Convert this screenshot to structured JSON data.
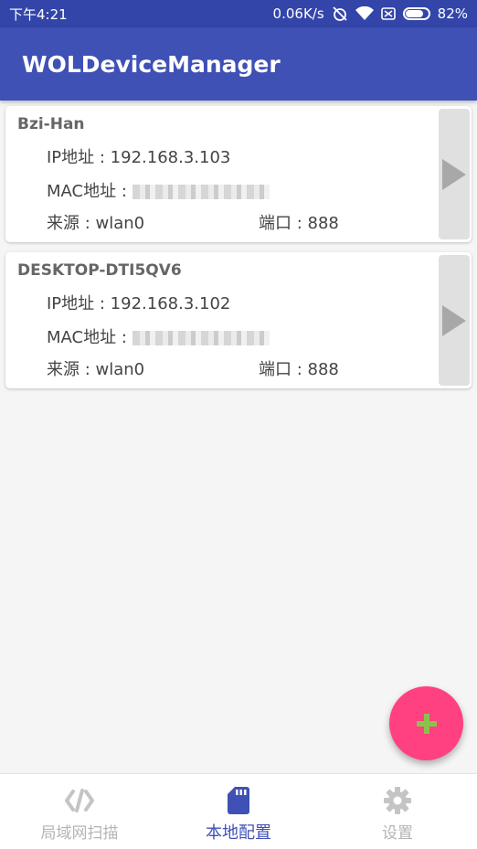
{
  "status_bar": {
    "time": "下午4:21",
    "network_speed": "0.06K/s",
    "battery": "82%",
    "icons": [
      "alarm-off-icon",
      "wifi-icon",
      "sim-icon",
      "battery-icon"
    ]
  },
  "app": {
    "title": "WOLDeviceManager"
  },
  "devices": [
    {
      "name": "Bzi-Han",
      "ip_label": "IP地址 : 192.168.3.103",
      "mac_label": "MAC地址 :",
      "source_label": "来源 : wlan0",
      "port_label": "端口 : 888"
    },
    {
      "name": "DESKTOP-DTI5QV6",
      "ip_label": "IP地址 : 192.168.3.102",
      "mac_label": "MAC地址 :",
      "source_label": "来源 : wlan0",
      "port_label": "端口 : 888"
    }
  ],
  "fab": {
    "icon": "plus-icon"
  },
  "bottom_nav": [
    {
      "label": "局域网扫描",
      "icon": "code-icon",
      "active": false
    },
    {
      "label": "本地配置",
      "icon": "sd-card-icon",
      "active": true
    },
    {
      "label": "设置",
      "icon": "gear-icon",
      "active": false
    }
  ],
  "colors": {
    "primary": "#3f51b5",
    "primary_dark": "#3345a8",
    "accent": "#ff4081",
    "fab_plus": "#8bc34a"
  }
}
